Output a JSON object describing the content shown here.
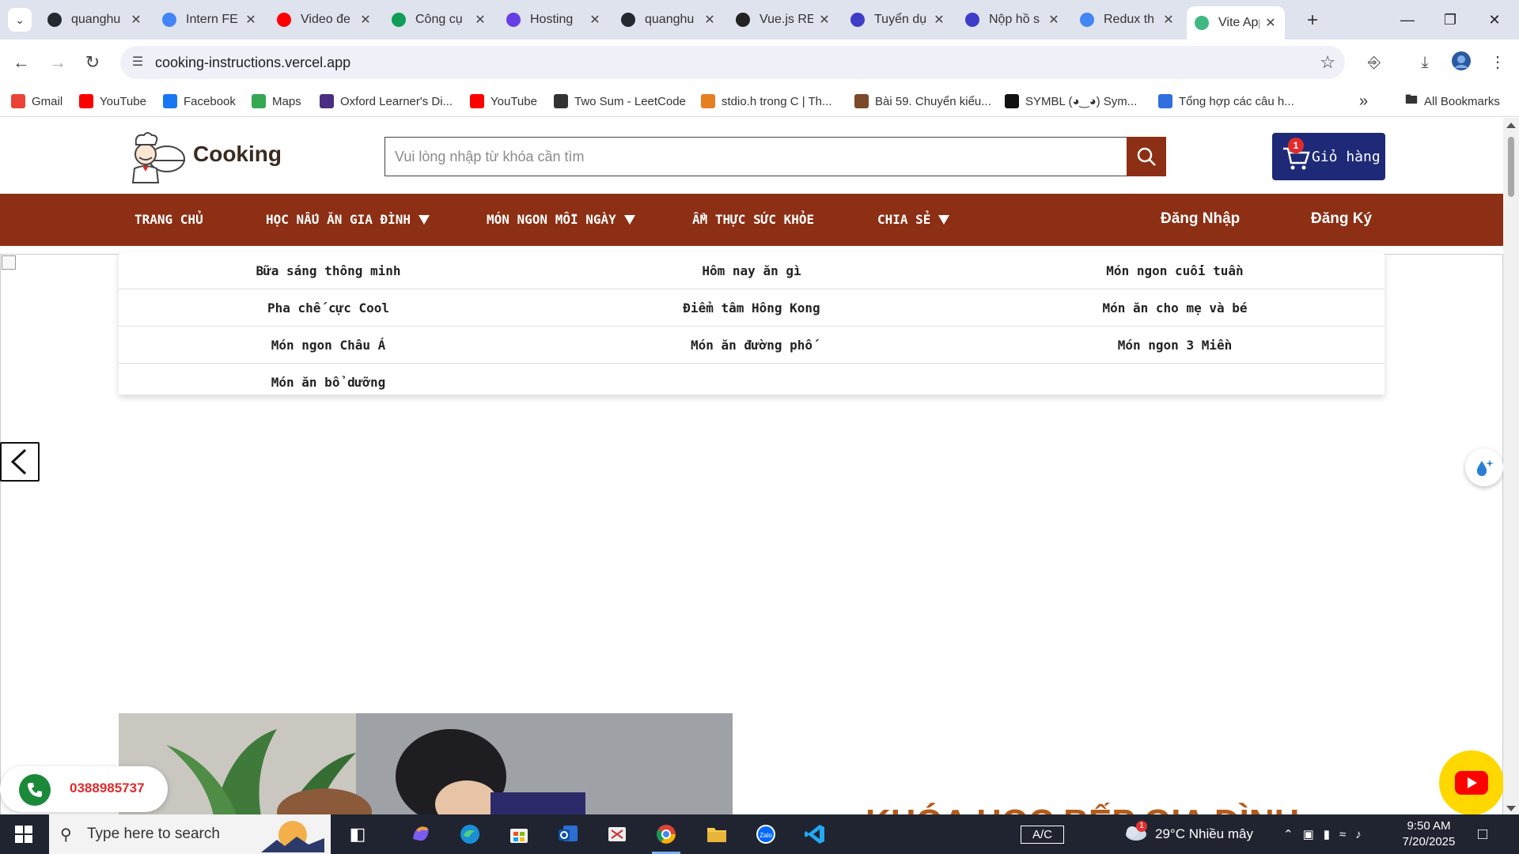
{
  "browser": {
    "tabs": [
      {
        "title": "quanghu",
        "icon": "github-icon",
        "color": "#24292f"
      },
      {
        "title": "Intern FE",
        "icon": "docs-icon",
        "color": "#4285f4"
      },
      {
        "title": "Video đe",
        "icon": "youtube-icon",
        "color": "#ff0000"
      },
      {
        "title": "Công cụ",
        "icon": "sheets-icon",
        "color": "#0f9d58"
      },
      {
        "title": "Hosting",
        "icon": "hostinger-icon",
        "color": "#673de6"
      },
      {
        "title": "quanghu",
        "icon": "github-icon",
        "color": "#24292f"
      },
      {
        "title": "Vue.js RE",
        "icon": "openai-icon",
        "color": "#222222"
      },
      {
        "title": "Tuyển dụ",
        "icon": "c-icon",
        "color": "#3d3dc7"
      },
      {
        "title": "Nộp hồ s",
        "icon": "c-icon",
        "color": "#3d3dc7"
      },
      {
        "title": "Redux th",
        "icon": "google-icon",
        "color": "#4285f4"
      },
      {
        "title": "Vite App",
        "icon": "vue-icon",
        "color": "#41b883"
      }
    ],
    "url": "cooking-instructions.vercel.app",
    "bookmarks": [
      {
        "label": "Gmail",
        "icon": "gmail-icon",
        "color": "#ea4335"
      },
      {
        "label": "YouTube",
        "icon": "youtube-icon",
        "color": "#ff0000"
      },
      {
        "label": "Facebook",
        "icon": "facebook-icon",
        "color": "#1877f2"
      },
      {
        "label": "Maps",
        "icon": "maps-icon",
        "color": "#34a853"
      },
      {
        "label": "Oxford Learner's Di...",
        "icon": "oxford-icon",
        "color": "#4b2e83"
      },
      {
        "label": "YouTube",
        "icon": "youtube-icon",
        "color": "#ff0000"
      },
      {
        "label": "Two Sum - LeetCode",
        "icon": "leetcode-icon",
        "color": "#333333"
      },
      {
        "label": "stdio.h trong C | Th...",
        "icon": "j-icon",
        "color": "#e67e22"
      },
      {
        "label": "Bài 59. Chuyển kiểu...",
        "icon": "person-icon",
        "color": "#7a4a2a"
      },
      {
        "label": "SYMBL (◕‿◕) Sym...",
        "icon": "symbl-icon",
        "color": "#111111"
      },
      {
        "label": "Tổng hợp các câu h...",
        "icon": "diamond-icon",
        "color": "#2f6fe0"
      }
    ],
    "all_bookmarks": "All Bookmarks"
  },
  "site": {
    "brand": "Cooking",
    "search_placeholder": "Vui lòng nhập từ khóa cần tìm",
    "cart_label": "Giỏ hàng",
    "cart_count": "1",
    "menu": [
      {
        "label": "TRANG CHỦ",
        "has_caret": false
      },
      {
        "label": "HỌC NẤU ĂN GIA ĐÌNH",
        "has_caret": true
      },
      {
        "label": "MÓN NGON MỖI NGÀY",
        "has_caret": true
      },
      {
        "label": "ẨM THỰC SỨC KHỎE",
        "has_caret": false
      },
      {
        "label": "CHIA SẺ",
        "has_caret": true
      }
    ],
    "login": "Đăng Nhập",
    "register": "Đăng Ký",
    "dropdown_rows": [
      [
        "Bữa sáng thông minh",
        "Hôm nay ăn gì",
        "Món ngon cuối tuần"
      ],
      [
        "Pha chế cực Cool",
        "Điểm tâm Hông Kong",
        "Món ăn cho mẹ và bé"
      ],
      [
        "Món ngon Châu Á",
        "Món ăn đường phố",
        "Món ngon 3 Miền"
      ],
      [
        "Món ăn bổ dưỡng",
        "",
        ""
      ]
    ],
    "course_title": "KHÓA HỌC BẾP GIA ĐÌNH",
    "phone": "0388985737",
    "colors": {
      "primary": "#8c2f14",
      "cart": "#1e2a78",
      "phone": "#e02b2b"
    }
  },
  "taskbar": {
    "search_placeholder": "Type here to search",
    "weather": "29°C  Nhiều mây",
    "weather_badge": "1",
    "keyboard": "A/C",
    "time": "9:50 AM",
    "date": "7/20/2025"
  }
}
